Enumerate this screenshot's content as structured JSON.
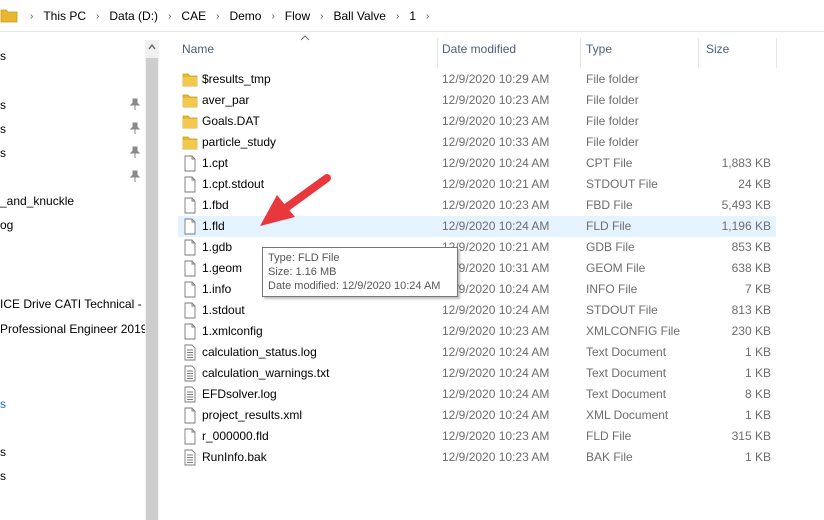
{
  "breadcrumbs": [
    "This PC",
    "Data (D:)",
    "CAE",
    "Demo",
    "Flow",
    "Ball Valve",
    "1"
  ],
  "nav": [
    {
      "label": "s",
      "pinned": false
    },
    {
      "label": "s",
      "pinned": true
    },
    {
      "label": "s",
      "pinned": true
    },
    {
      "label": "s",
      "pinned": true
    },
    {
      "label": "",
      "pinned": true
    },
    {
      "label": "_and_knuckle",
      "pinned": false
    },
    {
      "label": "og",
      "pinned": false
    },
    {
      "label": "ICE Drive CATI Technical - R",
      "pinned": false
    },
    {
      "label": "Professional Engineer 2019",
      "pinned": false
    },
    {
      "label": "s",
      "pinned": false
    },
    {
      "label": "s",
      "pinned": false
    },
    {
      "label": "s",
      "pinned": false
    }
  ],
  "columns": {
    "name": "Name",
    "date": "Date modified",
    "type": "Type",
    "size": "Size"
  },
  "files": [
    {
      "name": "$results_tmp",
      "date": "12/9/2020 10:29 AM",
      "type": "File folder",
      "size": "",
      "icon": "folder"
    },
    {
      "name": "aver_par",
      "date": "12/9/2020 10:23 AM",
      "type": "File folder",
      "size": "",
      "icon": "folder"
    },
    {
      "name": "Goals.DAT",
      "date": "12/9/2020 10:23 AM",
      "type": "File folder",
      "size": "",
      "icon": "folder"
    },
    {
      "name": "particle_study",
      "date": "12/9/2020 10:33 AM",
      "type": "File folder",
      "size": "",
      "icon": "folder"
    },
    {
      "name": "1.cpt",
      "date": "12/9/2020 10:24 AM",
      "type": "CPT File",
      "size": "1,883 KB",
      "icon": "file"
    },
    {
      "name": "1.cpt.stdout",
      "date": "12/9/2020 10:21 AM",
      "type": "STDOUT File",
      "size": "24 KB",
      "icon": "file"
    },
    {
      "name": "1.fbd",
      "date": "12/9/2020 10:23 AM",
      "type": "FBD File",
      "size": "5,493 KB",
      "icon": "file"
    },
    {
      "name": "1.fld",
      "date": "12/9/2020 10:24 AM",
      "type": "FLD File",
      "size": "1,196 KB",
      "icon": "file"
    },
    {
      "name": "1.gdb",
      "date": "12/9/2020 10:21 AM",
      "type": "GDB File",
      "size": "853 KB",
      "icon": "file"
    },
    {
      "name": "1.geom",
      "date": "12/9/2020 10:31 AM",
      "type": "GEOM File",
      "size": "638 KB",
      "icon": "file"
    },
    {
      "name": "1.info",
      "date": "12/9/2020 10:24 AM",
      "type": "INFO File",
      "size": "7 KB",
      "icon": "file"
    },
    {
      "name": "1.stdout",
      "date": "12/9/2020 10:24 AM",
      "type": "STDOUT File",
      "size": "813 KB",
      "icon": "file"
    },
    {
      "name": "1.xmlconfig",
      "date": "12/9/2020 10:23 AM",
      "type": "XMLCONFIG File",
      "size": "230 KB",
      "icon": "file"
    },
    {
      "name": "calculation_status.log",
      "date": "12/9/2020 10:24 AM",
      "type": "Text Document",
      "size": "1 KB",
      "icon": "text"
    },
    {
      "name": "calculation_warnings.txt",
      "date": "12/9/2020 10:24 AM",
      "type": "Text Document",
      "size": "1 KB",
      "icon": "text"
    },
    {
      "name": "EFDsolver.log",
      "date": "12/9/2020 10:24 AM",
      "type": "Text Document",
      "size": "8 KB",
      "icon": "text"
    },
    {
      "name": "project_results.xml",
      "date": "12/9/2020 10:24 AM",
      "type": "XML Document",
      "size": "1 KB",
      "icon": "file"
    },
    {
      "name": "r_000000.fld",
      "date": "12/9/2020 10:23 AM",
      "type": "FLD File",
      "size": "315 KB",
      "icon": "file"
    },
    {
      "name": "RunInfo.bak",
      "date": "12/9/2020 10:23 AM",
      "type": "BAK File",
      "size": "1 KB",
      "icon": "text"
    }
  ],
  "hover_index": 7,
  "tooltip": {
    "type_line": "Type: FLD File",
    "size_line": "Size: 1.16 MB",
    "date_line": "Date modified: 12/9/2020 10:24 AM"
  },
  "colors": {
    "folder": "#e8b730",
    "hover": "#e5f3ff",
    "arrow": "#e8383d",
    "header_text": "#4c607a"
  }
}
